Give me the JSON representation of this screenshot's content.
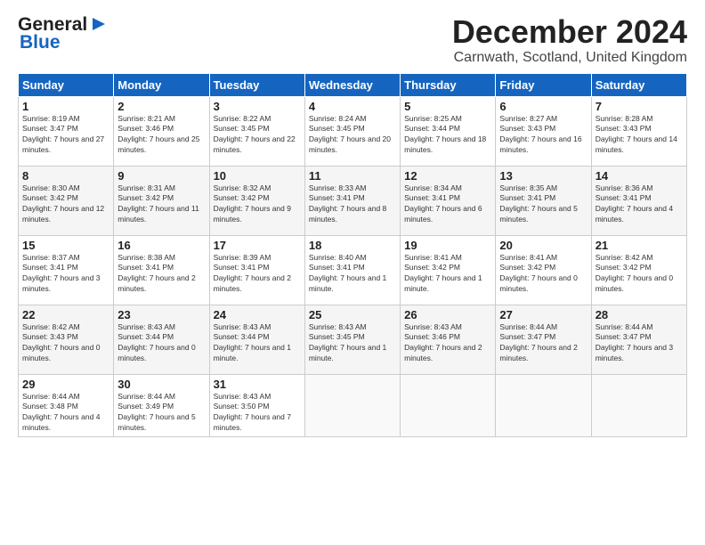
{
  "header": {
    "logo_line1": "General",
    "logo_line2": "Blue",
    "month": "December 2024",
    "location": "Carnwath, Scotland, United Kingdom"
  },
  "weekdays": [
    "Sunday",
    "Monday",
    "Tuesday",
    "Wednesday",
    "Thursday",
    "Friday",
    "Saturday"
  ],
  "weeks": [
    [
      {
        "day": "1",
        "sunrise": "Sunrise: 8:19 AM",
        "sunset": "Sunset: 3:47 PM",
        "daylight": "Daylight: 7 hours and 27 minutes."
      },
      {
        "day": "2",
        "sunrise": "Sunrise: 8:21 AM",
        "sunset": "Sunset: 3:46 PM",
        "daylight": "Daylight: 7 hours and 25 minutes."
      },
      {
        "day": "3",
        "sunrise": "Sunrise: 8:22 AM",
        "sunset": "Sunset: 3:45 PM",
        "daylight": "Daylight: 7 hours and 22 minutes."
      },
      {
        "day": "4",
        "sunrise": "Sunrise: 8:24 AM",
        "sunset": "Sunset: 3:45 PM",
        "daylight": "Daylight: 7 hours and 20 minutes."
      },
      {
        "day": "5",
        "sunrise": "Sunrise: 8:25 AM",
        "sunset": "Sunset: 3:44 PM",
        "daylight": "Daylight: 7 hours and 18 minutes."
      },
      {
        "day": "6",
        "sunrise": "Sunrise: 8:27 AM",
        "sunset": "Sunset: 3:43 PM",
        "daylight": "Daylight: 7 hours and 16 minutes."
      },
      {
        "day": "7",
        "sunrise": "Sunrise: 8:28 AM",
        "sunset": "Sunset: 3:43 PM",
        "daylight": "Daylight: 7 hours and 14 minutes."
      }
    ],
    [
      {
        "day": "8",
        "sunrise": "Sunrise: 8:30 AM",
        "sunset": "Sunset: 3:42 PM",
        "daylight": "Daylight: 7 hours and 12 minutes."
      },
      {
        "day": "9",
        "sunrise": "Sunrise: 8:31 AM",
        "sunset": "Sunset: 3:42 PM",
        "daylight": "Daylight: 7 hours and 11 minutes."
      },
      {
        "day": "10",
        "sunrise": "Sunrise: 8:32 AM",
        "sunset": "Sunset: 3:42 PM",
        "daylight": "Daylight: 7 hours and 9 minutes."
      },
      {
        "day": "11",
        "sunrise": "Sunrise: 8:33 AM",
        "sunset": "Sunset: 3:41 PM",
        "daylight": "Daylight: 7 hours and 8 minutes."
      },
      {
        "day": "12",
        "sunrise": "Sunrise: 8:34 AM",
        "sunset": "Sunset: 3:41 PM",
        "daylight": "Daylight: 7 hours and 6 minutes."
      },
      {
        "day": "13",
        "sunrise": "Sunrise: 8:35 AM",
        "sunset": "Sunset: 3:41 PM",
        "daylight": "Daylight: 7 hours and 5 minutes."
      },
      {
        "day": "14",
        "sunrise": "Sunrise: 8:36 AM",
        "sunset": "Sunset: 3:41 PM",
        "daylight": "Daylight: 7 hours and 4 minutes."
      }
    ],
    [
      {
        "day": "15",
        "sunrise": "Sunrise: 8:37 AM",
        "sunset": "Sunset: 3:41 PM",
        "daylight": "Daylight: 7 hours and 3 minutes."
      },
      {
        "day": "16",
        "sunrise": "Sunrise: 8:38 AM",
        "sunset": "Sunset: 3:41 PM",
        "daylight": "Daylight: 7 hours and 2 minutes."
      },
      {
        "day": "17",
        "sunrise": "Sunrise: 8:39 AM",
        "sunset": "Sunset: 3:41 PM",
        "daylight": "Daylight: 7 hours and 2 minutes."
      },
      {
        "day": "18",
        "sunrise": "Sunrise: 8:40 AM",
        "sunset": "Sunset: 3:41 PM",
        "daylight": "Daylight: 7 hours and 1 minute."
      },
      {
        "day": "19",
        "sunrise": "Sunrise: 8:41 AM",
        "sunset": "Sunset: 3:42 PM",
        "daylight": "Daylight: 7 hours and 1 minute."
      },
      {
        "day": "20",
        "sunrise": "Sunrise: 8:41 AM",
        "sunset": "Sunset: 3:42 PM",
        "daylight": "Daylight: 7 hours and 0 minutes."
      },
      {
        "day": "21",
        "sunrise": "Sunrise: 8:42 AM",
        "sunset": "Sunset: 3:42 PM",
        "daylight": "Daylight: 7 hours and 0 minutes."
      }
    ],
    [
      {
        "day": "22",
        "sunrise": "Sunrise: 8:42 AM",
        "sunset": "Sunset: 3:43 PM",
        "daylight": "Daylight: 7 hours and 0 minutes."
      },
      {
        "day": "23",
        "sunrise": "Sunrise: 8:43 AM",
        "sunset": "Sunset: 3:44 PM",
        "daylight": "Daylight: 7 hours and 0 minutes."
      },
      {
        "day": "24",
        "sunrise": "Sunrise: 8:43 AM",
        "sunset": "Sunset: 3:44 PM",
        "daylight": "Daylight: 7 hours and 1 minute."
      },
      {
        "day": "25",
        "sunrise": "Sunrise: 8:43 AM",
        "sunset": "Sunset: 3:45 PM",
        "daylight": "Daylight: 7 hours and 1 minute."
      },
      {
        "day": "26",
        "sunrise": "Sunrise: 8:43 AM",
        "sunset": "Sunset: 3:46 PM",
        "daylight": "Daylight: 7 hours and 2 minutes."
      },
      {
        "day": "27",
        "sunrise": "Sunrise: 8:44 AM",
        "sunset": "Sunset: 3:47 PM",
        "daylight": "Daylight: 7 hours and 2 minutes."
      },
      {
        "day": "28",
        "sunrise": "Sunrise: 8:44 AM",
        "sunset": "Sunset: 3:47 PM",
        "daylight": "Daylight: 7 hours and 3 minutes."
      }
    ],
    [
      {
        "day": "29",
        "sunrise": "Sunrise: 8:44 AM",
        "sunset": "Sunset: 3:48 PM",
        "daylight": "Daylight: 7 hours and 4 minutes."
      },
      {
        "day": "30",
        "sunrise": "Sunrise: 8:44 AM",
        "sunset": "Sunset: 3:49 PM",
        "daylight": "Daylight: 7 hours and 5 minutes."
      },
      {
        "day": "31",
        "sunrise": "Sunrise: 8:43 AM",
        "sunset": "Sunset: 3:50 PM",
        "daylight": "Daylight: 7 hours and 7 minutes."
      },
      null,
      null,
      null,
      null
    ]
  ]
}
